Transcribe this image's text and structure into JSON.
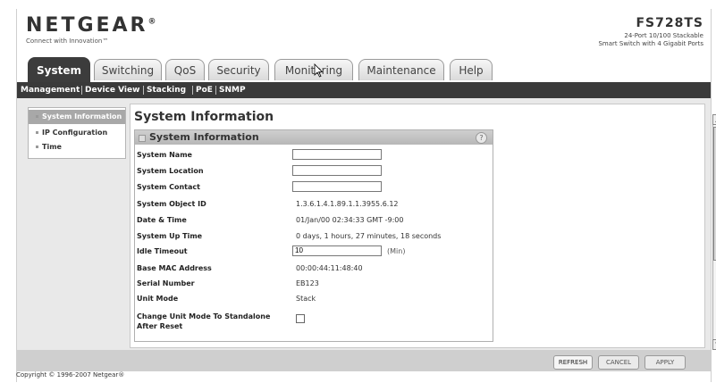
{
  "brand": {
    "logo": "NETGEAR",
    "trademark": "®",
    "tagline": "Connect with Innovation™"
  },
  "model": {
    "name": "FS728TS",
    "desc_line1": "24-Port 10/100 Stackable",
    "desc_line2": "Smart Switch with 4 Gigabit Ports"
  },
  "tabs": [
    {
      "label": "System"
    },
    {
      "label": "Switching"
    },
    {
      "label": "QoS"
    },
    {
      "label": "Security"
    },
    {
      "label": "Monitoring"
    },
    {
      "label": "Maintenance"
    },
    {
      "label": "Help"
    }
  ],
  "subnav": [
    {
      "label": "Management"
    },
    {
      "label": "Device View"
    },
    {
      "label": "Stacking"
    },
    {
      "label": "PoE"
    },
    {
      "label": "SNMP"
    }
  ],
  "sidemenu": [
    {
      "label": "System Information"
    },
    {
      "label": "IP Configuration"
    },
    {
      "label": "Time"
    }
  ],
  "page_title": "System Information",
  "panel_title": "System Information",
  "fields": {
    "system_name": {
      "label": "System Name",
      "value": ""
    },
    "system_location": {
      "label": "System Location",
      "value": ""
    },
    "system_contact": {
      "label": "System Contact",
      "value": ""
    },
    "system_object_id": {
      "label": "System Object ID",
      "value": "1.3.6.1.4.1.89.1.1.3955.6.12"
    },
    "date_time": {
      "label": "Date & Time",
      "value": "01/Jan/00  02:34:33 GMT -9:00"
    },
    "system_up_time": {
      "label": "System Up Time",
      "value": "0 days, 1 hours, 27 minutes, 18 seconds"
    },
    "idle_timeout": {
      "label": "Idle Timeout",
      "value": "10",
      "unit": "(Min)"
    },
    "base_mac": {
      "label": "Base MAC Address",
      "value": "00:00:44:11:48:40"
    },
    "serial_number": {
      "label": "Serial Number",
      "value": "EB123"
    },
    "unit_mode": {
      "label": "Unit Mode",
      "value": "Stack"
    },
    "change_unit_mode": {
      "label_line1": "Change Unit Mode To Standalone",
      "label_line2": "After Reset",
      "checked": false
    }
  },
  "buttons": {
    "refresh": "REFRESH",
    "cancel": "CANCEL",
    "apply": "APPLY"
  },
  "copyright": "Copyright © 1996-2007 Netgear®",
  "icons": {
    "help": "help-icon",
    "cursor": "mouse-cursor-icon"
  }
}
